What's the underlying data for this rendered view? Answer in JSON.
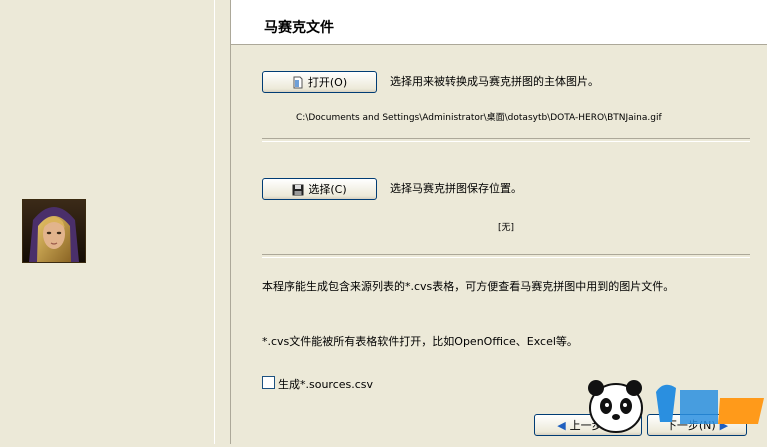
{
  "header": {
    "title": "马赛克文件"
  },
  "source": {
    "open_label": "打开(O)",
    "description": "选择用来被转换成马赛克拼图的主体图片。",
    "path": "C:\\Documents and Settings\\Administrator\\桌面\\dotasytb\\DOTA-HERO\\BTNJaina.gif"
  },
  "output": {
    "choose_label": "选择(C)",
    "description": "选择马赛克拼图保存位置。",
    "path": "[无]"
  },
  "info": {
    "line1": "本程序能生成包含来源列表的*.cvs表格，可方便查看马赛克拼图中用到的图片文件。",
    "line2": "*.cvs文件能被所有表格软件打开，比如OpenOffice、Excel等。"
  },
  "options": {
    "generate_sources_label": "生成*.sources.csv",
    "generate_sources_checked": false
  },
  "nav": {
    "back_label": "上一步(B)",
    "next_label": "下一步(N)"
  },
  "colors": {
    "accent": "#003c74",
    "window_bg": "#ece9d8",
    "header_bg": "#ffffff"
  },
  "icons": [
    "open-file-icon",
    "save-disk-icon",
    "back-arrow-icon",
    "next-arrow-icon"
  ]
}
